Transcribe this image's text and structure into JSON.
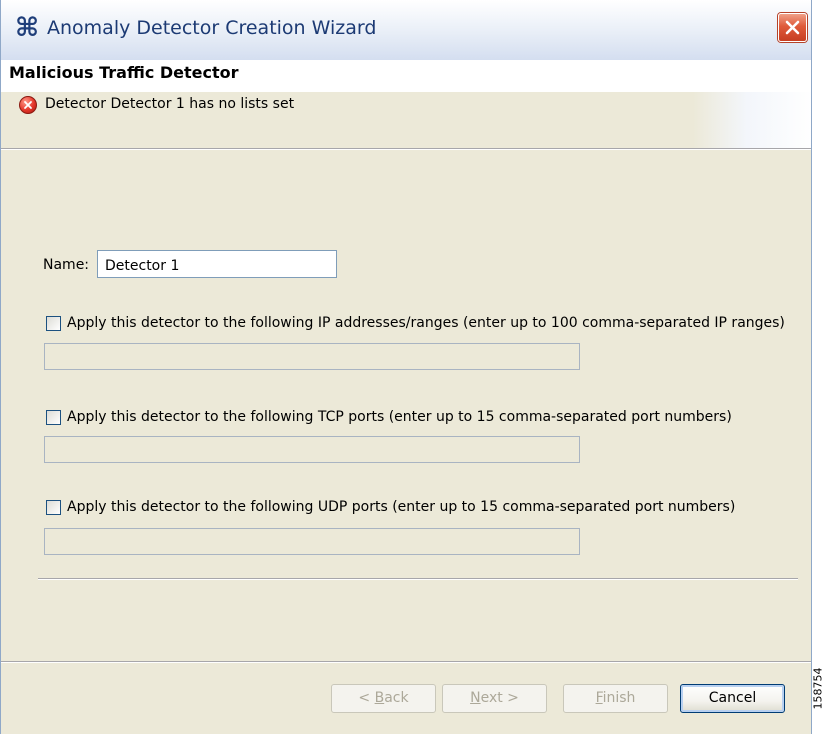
{
  "window": {
    "title": "Anomaly Detector Creation Wizard",
    "app_icon": "wizard-icon",
    "close_icon": "close-icon"
  },
  "header": {
    "title": "Malicious Traffic Detector",
    "message": "Detector Detector 1 has no lists set",
    "message_icon": "error-icon"
  },
  "form": {
    "name_label": "Name:",
    "name_value": "Detector 1",
    "ip": {
      "label": "Apply this detector to the following IP addresses/ranges (enter up to 100 comma-separated IP ranges)",
      "checked": false,
      "value": ""
    },
    "tcp": {
      "label": "Apply this detector to the following TCP ports (enter up to 15 comma-separated port numbers)",
      "checked": false,
      "value": ""
    },
    "udp": {
      "label": "Apply this detector to the following UDP ports (enter up to 15 comma-separated port numbers)",
      "checked": false,
      "value": ""
    }
  },
  "buttons": {
    "back": {
      "pre": "< ",
      "mnemonic": "B",
      "post": "ack",
      "enabled": false
    },
    "next": {
      "pre": "",
      "mnemonic": "N",
      "post": "ext >",
      "enabled": false
    },
    "finish": {
      "pre": "",
      "mnemonic": "F",
      "post": "inish",
      "enabled": false
    },
    "cancel": {
      "label": "Cancel",
      "enabled": true
    }
  },
  "figure_number": "158754",
  "colors": {
    "title_text": "#1c3a74",
    "dialog_bg": "#ece9d8",
    "close_button": "#df5a3a",
    "error_icon": "#e4362a"
  }
}
